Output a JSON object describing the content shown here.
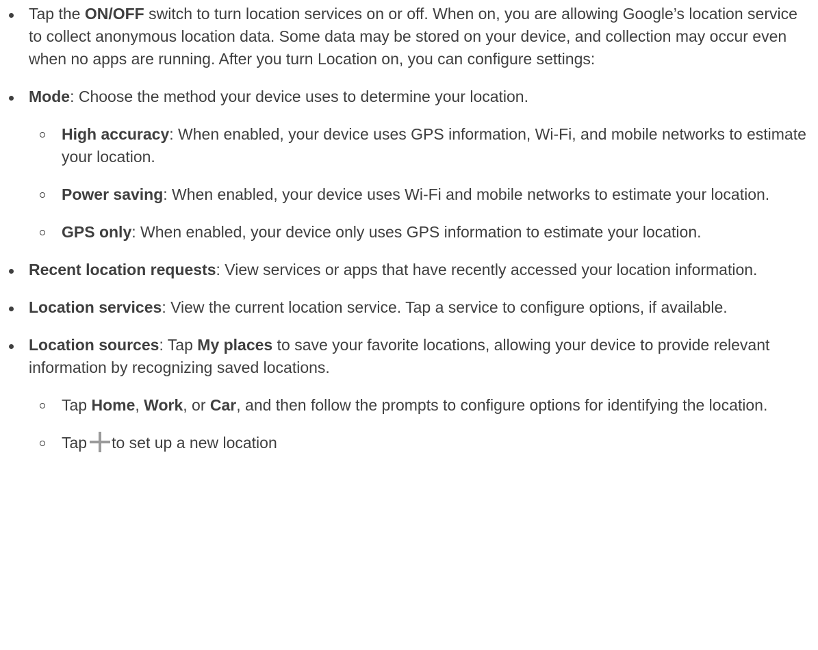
{
  "items": [
    {
      "lead": "Tap the ",
      "bold": "ON/OFF",
      "text": " switch to turn location services on or off. When on, you are allowing Google’s location service to collect anonymous location data. Some data may be stored on your device, and collection may occur even when no apps are running. After you turn Location on, you can configure settings:"
    },
    {
      "bold": "Mode",
      "text": ": Choose the method your device uses to determine your location.",
      "subitems": [
        {
          "bold": "High accuracy",
          "text": ": When enabled, your device uses GPS information, Wi-Fi, and mobile networks to estimate your location."
        },
        {
          "bold": "Power saving",
          "text": ": When enabled, your device uses Wi-Fi and mobile networks to estimate your location."
        },
        {
          "bold": "GPS only",
          "text": ": When enabled, your device only uses GPS information to estimate your location."
        }
      ]
    },
    {
      "bold": "Recent location requests",
      "text": ": View services or apps that have recently accessed your location information."
    },
    {
      "bold": "Location services",
      "text": ": View the current location service. Tap a service to configure options, if available."
    },
    {
      "bold": "Location sources",
      "text_a": ": Tap ",
      "bold_b": "My places",
      "text_b": " to save your favorite locations, allowing your device to provide relevant information by recognizing saved locations.",
      "subitems": [
        {
          "lead": "Tap ",
          "bold_home": "Home",
          "sep1": ", ",
          "bold_work": "Work",
          "sep2": ", or ",
          "bold_car": "Car",
          "text": ", and then follow the prompts to configure options for identifying the location."
        },
        {
          "lead": "Tap",
          "icon": "plus-icon",
          "text": "to set up a new location"
        }
      ]
    }
  ]
}
